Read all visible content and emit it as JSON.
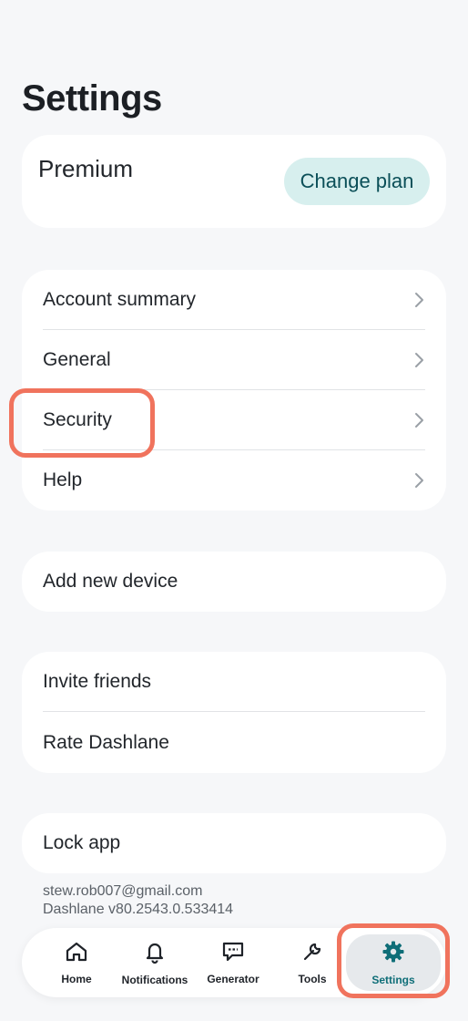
{
  "page": {
    "title": "Settings"
  },
  "premium": {
    "label": "Premium",
    "button": "Change plan"
  },
  "group1": [
    {
      "label": "Account summary"
    },
    {
      "label": "General"
    },
    {
      "label": "Security"
    },
    {
      "label": "Help"
    }
  ],
  "group2": [
    {
      "label": "Add new device"
    }
  ],
  "group3": [
    {
      "label": "Invite friends"
    },
    {
      "label": "Rate Dashlane"
    }
  ],
  "group4": [
    {
      "label": "Lock app"
    }
  ],
  "account": {
    "email": "stew.rob007@gmail.com",
    "version": "Dashlane v80.2543.0.533414"
  },
  "tabbar": [
    {
      "label": "Home",
      "icon": "home-icon"
    },
    {
      "label": "Notifications",
      "icon": "bell-icon"
    },
    {
      "label": "Generator",
      "icon": "generator-icon"
    },
    {
      "label": "Tools",
      "icon": "wrench-icon"
    },
    {
      "label": "Settings",
      "icon": "gear-icon",
      "active": true
    }
  ],
  "colors": {
    "accent": "#0f6e78",
    "highlight": "#f0735d",
    "plan_button_bg": "#d7efee"
  }
}
